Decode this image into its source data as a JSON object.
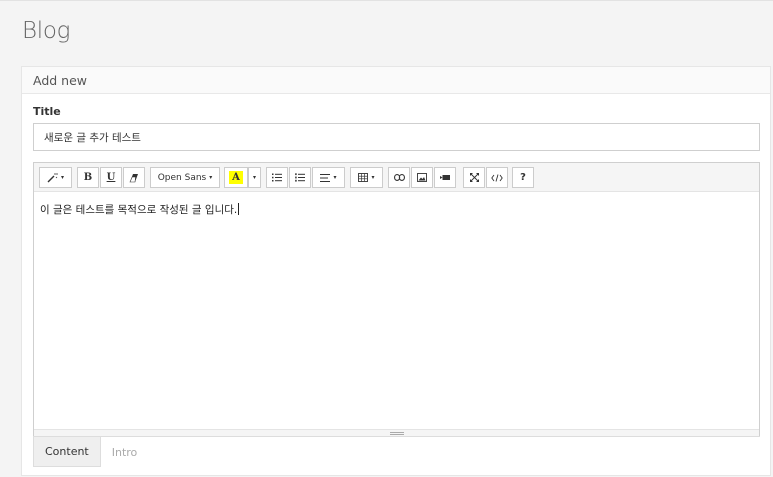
{
  "page": {
    "title": "Blog"
  },
  "panel": {
    "heading": "Add new"
  },
  "form": {
    "title_label": "Title",
    "title_value": "새로운 글 추가 테스트"
  },
  "toolbar": {
    "font_name": "Open Sans",
    "highlight_color": "#ffff00",
    "color_button_label": "A",
    "bold_label": "B",
    "underline_label": "U",
    "help_label": "?",
    "caret": "▾",
    "icons": [
      "magic-wand-icon",
      "bold-icon",
      "underline-icon",
      "eraser-icon",
      "font-family-dropdown",
      "text-color-icon",
      "unordered-list-icon",
      "ordered-list-icon",
      "align-icon",
      "table-icon",
      "link-icon",
      "image-icon",
      "video-icon",
      "fullscreen-icon",
      "code-view-icon",
      "help-icon"
    ]
  },
  "editor": {
    "content": "이 글은 테스트를 목적으로 작성된 글 입니다."
  },
  "tabs": [
    {
      "label": "Content",
      "active": true
    },
    {
      "label": "Intro",
      "active": false
    }
  ]
}
